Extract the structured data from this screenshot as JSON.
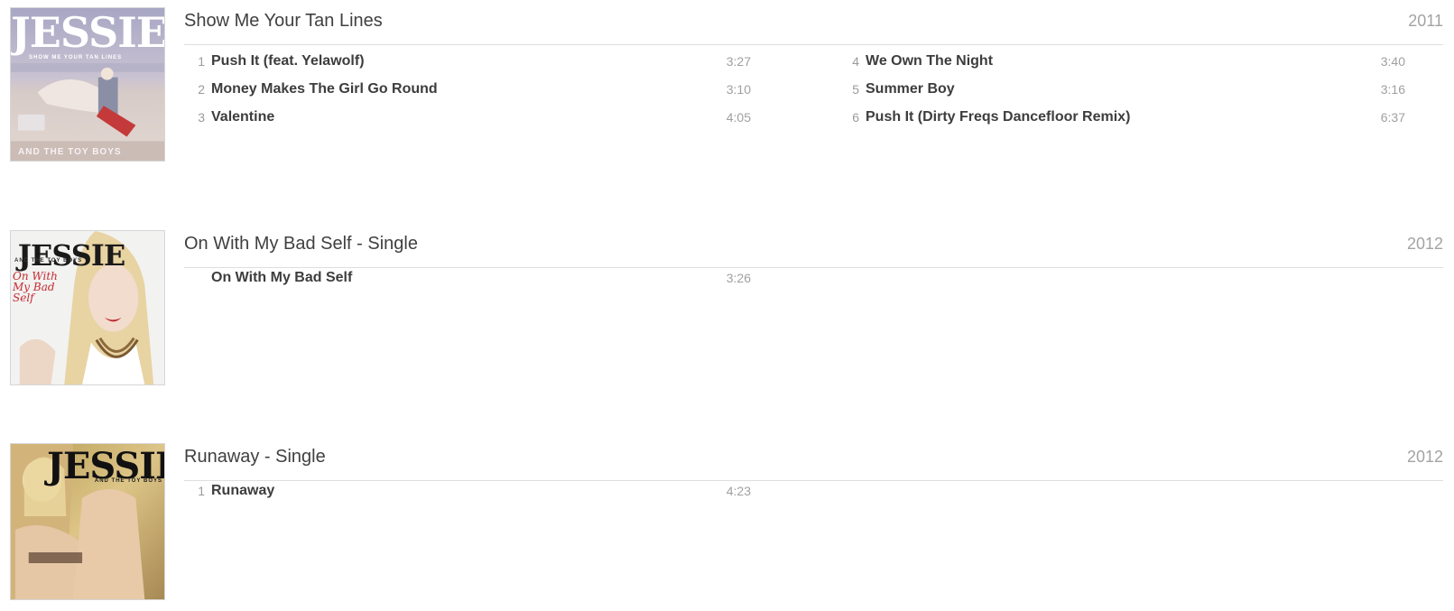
{
  "albums": [
    {
      "title": "Show Me Your Tan Lines",
      "year": "2011",
      "cover": {
        "brand": "JESSIE",
        "tagline": "SHOW ME YOUR TAN LINES",
        "subtitle": "AND THE TOY BOYS"
      },
      "tracks": [
        {
          "num": "1",
          "name": "Push It (feat. Yelawolf)",
          "duration": "3:27"
        },
        {
          "num": "2",
          "name": "Money Makes The Girl Go Round",
          "duration": "3:10"
        },
        {
          "num": "3",
          "name": "Valentine",
          "duration": "4:05"
        },
        {
          "num": "4",
          "name": "We Own The Night",
          "duration": "3:40"
        },
        {
          "num": "5",
          "name": "Summer Boy",
          "duration": "3:16"
        },
        {
          "num": "6",
          "name": "Push It (Dirty Freqs Dancefloor Remix)",
          "duration": "6:37"
        }
      ]
    },
    {
      "title": "On With My Bad Self - Single",
      "year": "2012",
      "cover": {
        "brand": "JESSIE",
        "subtitle": "AND THE TOY BOYS",
        "script": "On With My Bad Self"
      },
      "tracks": [
        {
          "num": "",
          "name": "On With My Bad Self",
          "duration": "3:26"
        }
      ]
    },
    {
      "title": "Runaway - Single",
      "year": "2012",
      "cover": {
        "brand": "JESSIE",
        "subtitle": "AND THE TOY BOYS"
      },
      "tracks": [
        {
          "num": "1",
          "name": "Runaway",
          "duration": "4:23"
        }
      ]
    }
  ]
}
